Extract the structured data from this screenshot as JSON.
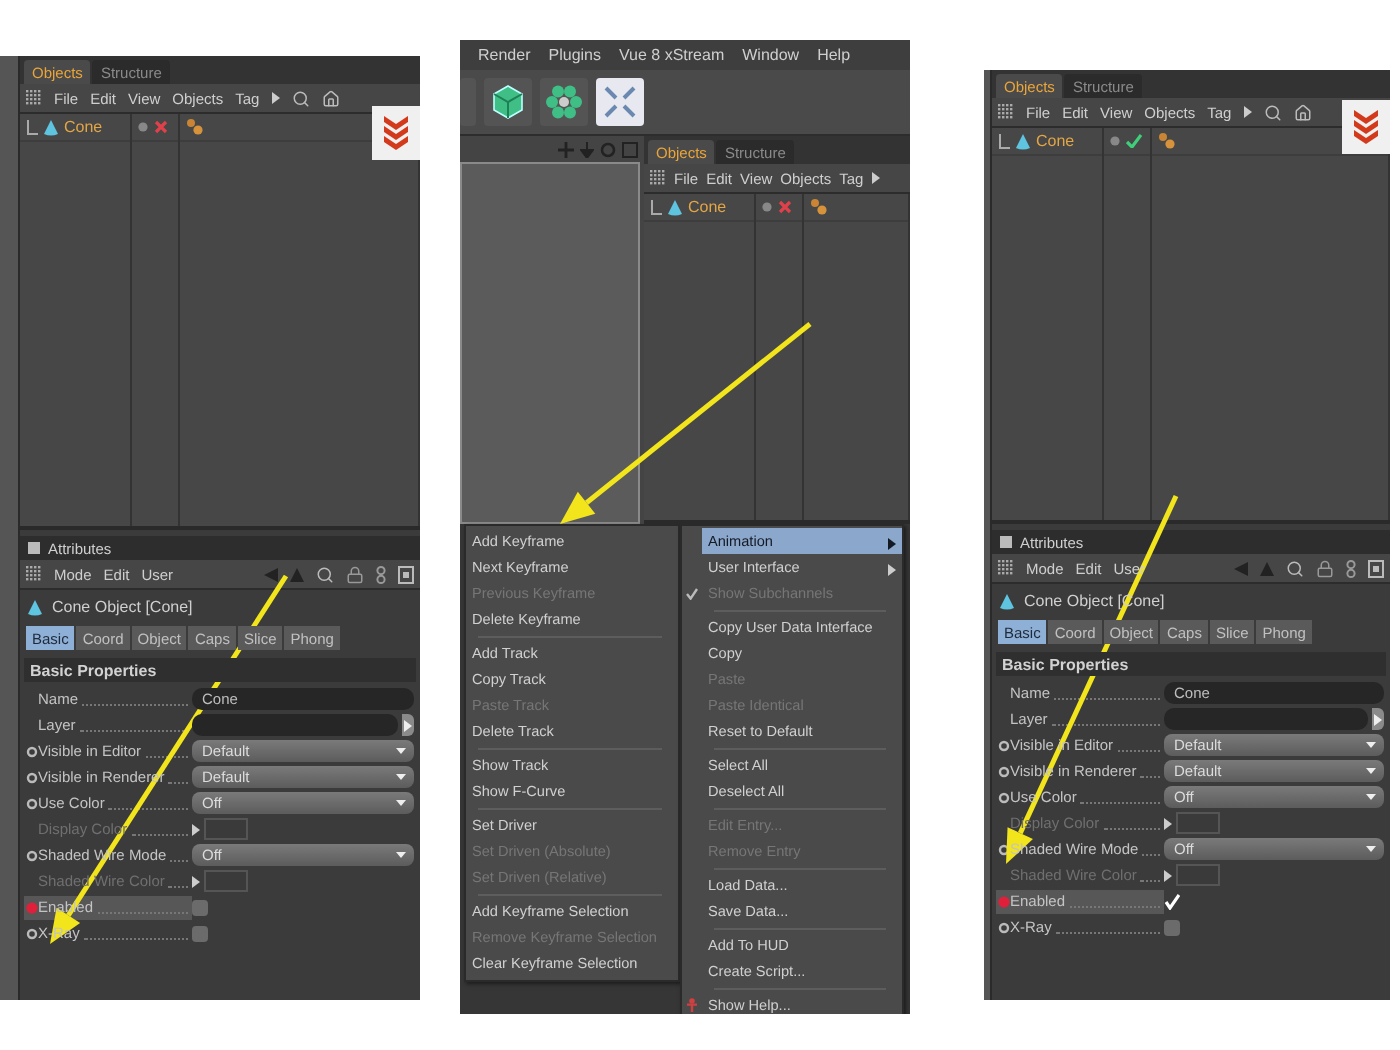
{
  "panels": [
    {
      "kind": "editor",
      "object_manager": {
        "tabs": [
          {
            "label": "Objects",
            "selected": true
          },
          {
            "label": "Structure",
            "selected": false
          }
        ],
        "menu": [
          "File",
          "Edit",
          "View",
          "Objects",
          "Tag"
        ],
        "object": {
          "name": "Cone",
          "enabled": false
        }
      },
      "attributes": {
        "title": "Attributes",
        "menu": [
          "Mode",
          "Edit",
          "User"
        ],
        "object_title": "Cone Object [Cone]",
        "tabs": [
          {
            "label": "Basic",
            "selected": true
          },
          {
            "label": "Coord",
            "selected": false
          },
          {
            "label": "Object",
            "selected": false
          },
          {
            "label": "Caps",
            "selected": false
          },
          {
            "label": "Slice",
            "selected": false
          },
          {
            "label": "Phong",
            "selected": false
          }
        ],
        "section": "Basic Properties",
        "rows": [
          {
            "kind": "text",
            "label": "Name",
            "value": "Cone",
            "track_dot": false,
            "disabled": false,
            "selected": false
          },
          {
            "kind": "field",
            "label": "Layer",
            "track_dot": false,
            "disabled": false,
            "selected": false
          },
          {
            "kind": "dropdown",
            "label": "Visible in Editor",
            "value": "Default",
            "track_dot": true,
            "animated": false,
            "disabled": false,
            "selected": false
          },
          {
            "kind": "dropdown",
            "label": "Visible in Renderer",
            "value": "Default",
            "track_dot": true,
            "animated": false,
            "disabled": false,
            "selected": false
          },
          {
            "kind": "dropdown",
            "label": "Use Color",
            "value": "Off",
            "track_dot": true,
            "animated": false,
            "disabled": false,
            "selected": false
          },
          {
            "kind": "color",
            "label": "Display Color",
            "track_dot": false,
            "disabled": true,
            "selected": false
          },
          {
            "kind": "dropdown",
            "label": "Shaded Wire Mode",
            "value": "Off",
            "track_dot": true,
            "animated": false,
            "disabled": false,
            "selected": false
          },
          {
            "kind": "color",
            "label": "Shaded Wire Color",
            "track_dot": false,
            "disabled": true,
            "selected": false
          },
          {
            "kind": "checkbox",
            "label": "Enabled",
            "checked": false,
            "track_dot": true,
            "animated": true,
            "disabled": false,
            "selected": true
          },
          {
            "kind": "checkbox",
            "label": "X-Ray",
            "checked": false,
            "track_dot": true,
            "animated": false,
            "disabled": false,
            "selected": false
          }
        ]
      }
    },
    {
      "kind": "menu",
      "menubar": [
        "Render",
        "Plugins",
        "Vue 8 xStream",
        "Window",
        "Help"
      ],
      "object_manager": {
        "tabs": [
          {
            "label": "Objects",
            "selected": true
          },
          {
            "label": "Structure",
            "selected": false
          }
        ],
        "menu": [
          "File",
          "Edit",
          "View",
          "Objects",
          "Tag"
        ],
        "object": {
          "name": "Cone",
          "enabled": false
        }
      },
      "context_menu": {
        "columns": [
          {
            "groups": [
              [
                {
                  "label": "Add Keyframe",
                  "kind": "command",
                  "disabled": false,
                  "selected": false,
                  "checked": false
                },
                {
                  "label": "Next Keyframe",
                  "kind": "command",
                  "disabled": false,
                  "selected": false,
                  "checked": false
                },
                {
                  "label": "Previous Keyframe",
                  "kind": "command",
                  "disabled": true,
                  "selected": false,
                  "checked": false
                },
                {
                  "label": "Delete Keyframe",
                  "kind": "command",
                  "disabled": false,
                  "selected": false,
                  "checked": false
                }
              ],
              [
                {
                  "label": "Add Track",
                  "kind": "command",
                  "disabled": false,
                  "selected": false,
                  "checked": false
                },
                {
                  "label": "Copy Track",
                  "kind": "command",
                  "disabled": false,
                  "selected": false,
                  "checked": false
                },
                {
                  "label": "Paste Track",
                  "kind": "command",
                  "disabled": true,
                  "selected": false,
                  "checked": false
                },
                {
                  "label": "Delete Track",
                  "kind": "command",
                  "disabled": false,
                  "selected": false,
                  "checked": false
                }
              ],
              [
                {
                  "label": "Show Track",
                  "kind": "command",
                  "disabled": false,
                  "selected": false,
                  "checked": false
                },
                {
                  "label": "Show F-Curve",
                  "kind": "command",
                  "disabled": false,
                  "selected": false,
                  "checked": false
                }
              ],
              [
                {
                  "label": "Set Driver",
                  "kind": "command",
                  "disabled": false,
                  "selected": false,
                  "checked": false
                },
                {
                  "label": "Set Driven (Absolute)",
                  "kind": "command",
                  "disabled": true,
                  "selected": false,
                  "checked": false
                },
                {
                  "label": "Set Driven (Relative)",
                  "kind": "command",
                  "disabled": true,
                  "selected": false,
                  "checked": false
                }
              ],
              [
                {
                  "label": "Add Keyframe Selection",
                  "kind": "command",
                  "disabled": false,
                  "selected": false,
                  "checked": false
                },
                {
                  "label": "Remove Keyframe Selection",
                  "kind": "command",
                  "disabled": true,
                  "selected": false,
                  "checked": false
                },
                {
                  "label": "Clear Keyframe Selection",
                  "kind": "command",
                  "disabled": false,
                  "selected": false,
                  "checked": false
                }
              ]
            ]
          },
          {
            "groups": [
              [
                {
                  "label": "Animation",
                  "kind": "submenu",
                  "disabled": false,
                  "selected": true,
                  "checked": false
                },
                {
                  "label": "User Interface",
                  "kind": "submenu",
                  "disabled": false,
                  "selected": false,
                  "checked": false
                },
                {
                  "label": "Show Subchannels",
                  "kind": "command",
                  "disabled": true,
                  "selected": false,
                  "checked": true
                }
              ],
              [
                {
                  "label": "Copy User Data Interface",
                  "kind": "command",
                  "disabled": false,
                  "selected": false,
                  "checked": false
                },
                {
                  "label": "Copy",
                  "kind": "command",
                  "disabled": false,
                  "selected": false,
                  "checked": false
                },
                {
                  "label": "Paste",
                  "kind": "command",
                  "disabled": true,
                  "selected": false,
                  "checked": false
                },
                {
                  "label": "Paste Identical",
                  "kind": "command",
                  "disabled": true,
                  "selected": false,
                  "checked": false
                },
                {
                  "label": "Reset to Default",
                  "kind": "command",
                  "disabled": false,
                  "selected": false,
                  "checked": false
                }
              ],
              [
                {
                  "label": "Select All",
                  "kind": "command",
                  "disabled": false,
                  "selected": false,
                  "checked": false
                },
                {
                  "label": "Deselect All",
                  "kind": "command",
                  "disabled": false,
                  "selected": false,
                  "checked": false
                }
              ],
              [
                {
                  "label": "Edit Entry...",
                  "kind": "command",
                  "disabled": true,
                  "selected": false,
                  "checked": false
                },
                {
                  "label": "Remove Entry",
                  "kind": "command",
                  "disabled": true,
                  "selected": false,
                  "checked": false
                }
              ],
              [
                {
                  "label": "Load Data...",
                  "kind": "command",
                  "disabled": false,
                  "selected": false,
                  "checked": false
                },
                {
                  "label": "Save Data...",
                  "kind": "command",
                  "disabled": false,
                  "selected": false,
                  "checked": false
                }
              ],
              [
                {
                  "label": "Add To HUD",
                  "kind": "command",
                  "disabled": false,
                  "selected": false,
                  "checked": false
                },
                {
                  "label": "Create Script...",
                  "kind": "command",
                  "disabled": false,
                  "selected": false,
                  "checked": false
                }
              ],
              [
                {
                  "label": "Show Help...",
                  "kind": "help",
                  "disabled": false,
                  "selected": false,
                  "checked": false
                }
              ]
            ]
          }
        ]
      }
    },
    {
      "kind": "editor",
      "object_manager": {
        "tabs": [
          {
            "label": "Objects",
            "selected": true
          },
          {
            "label": "Structure",
            "selected": false
          }
        ],
        "menu": [
          "File",
          "Edit",
          "View",
          "Objects",
          "Tag"
        ],
        "object": {
          "name": "Cone",
          "enabled": true
        }
      },
      "attributes": {
        "title": "Attributes",
        "menu": [
          "Mode",
          "Edit",
          "User"
        ],
        "object_title": "Cone Object [Cone]",
        "tabs": [
          {
            "label": "Basic",
            "selected": true
          },
          {
            "label": "Coord",
            "selected": false
          },
          {
            "label": "Object",
            "selected": false
          },
          {
            "label": "Caps",
            "selected": false
          },
          {
            "label": "Slice",
            "selected": false
          },
          {
            "label": "Phong",
            "selected": false
          }
        ],
        "section": "Basic Properties",
        "rows": [
          {
            "kind": "text",
            "label": "Name",
            "value": "Cone",
            "track_dot": false,
            "disabled": false,
            "selected": false
          },
          {
            "kind": "field",
            "label": "Layer",
            "track_dot": false,
            "disabled": false,
            "selected": false
          },
          {
            "kind": "dropdown",
            "label": "Visible in Editor",
            "value": "Default",
            "track_dot": true,
            "animated": false,
            "disabled": false,
            "selected": false
          },
          {
            "kind": "dropdown",
            "label": "Visible in Renderer",
            "value": "Default",
            "track_dot": true,
            "animated": false,
            "disabled": false,
            "selected": false
          },
          {
            "kind": "dropdown",
            "label": "Use Color",
            "value": "Off",
            "track_dot": true,
            "animated": false,
            "disabled": false,
            "selected": false
          },
          {
            "kind": "color",
            "label": "Display Color",
            "track_dot": false,
            "disabled": true,
            "selected": false
          },
          {
            "kind": "dropdown",
            "label": "Shaded Wire Mode",
            "value": "Off",
            "track_dot": true,
            "animated": false,
            "disabled": false,
            "selected": false
          },
          {
            "kind": "color",
            "label": "Shaded Wire Color",
            "track_dot": false,
            "disabled": true,
            "selected": false
          },
          {
            "kind": "checkbox",
            "label": "Enabled",
            "checked": true,
            "track_dot": true,
            "animated": true,
            "disabled": false,
            "selected": true
          },
          {
            "kind": "checkbox",
            "label": "X-Ray",
            "checked": false,
            "track_dot": true,
            "animated": false,
            "disabled": false,
            "selected": false
          }
        ]
      }
    }
  ]
}
